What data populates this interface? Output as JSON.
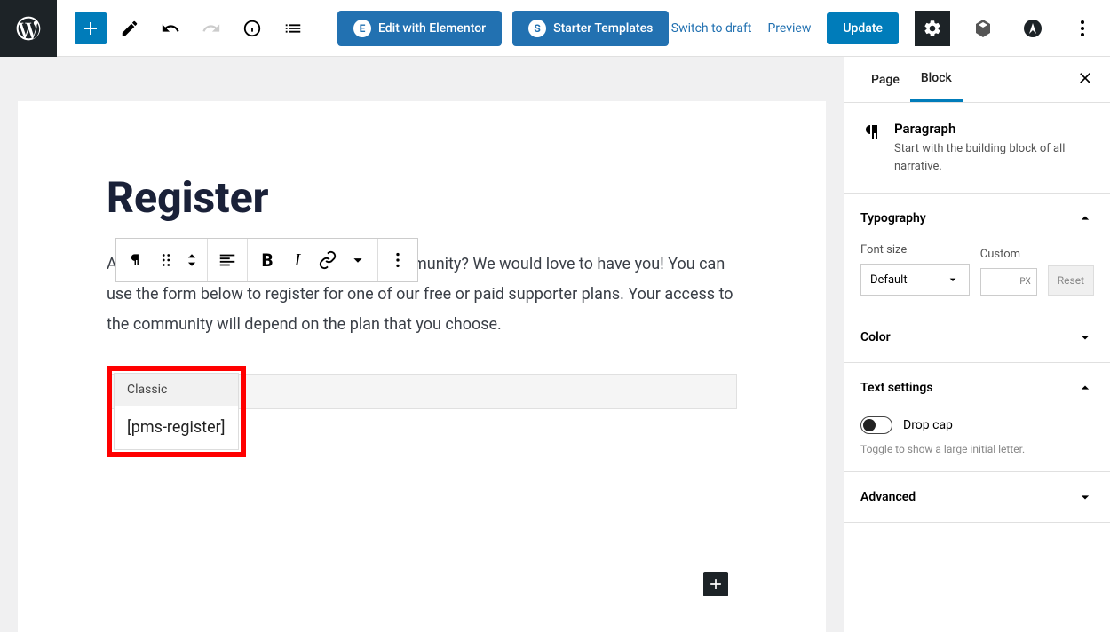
{
  "toolbar": {
    "elementor_label": "Edit with Elementor",
    "starter_label": "Starter Templates",
    "switch_draft": "Switch to draft",
    "preview": "Preview",
    "update": "Update"
  },
  "page": {
    "title": "Register",
    "paragraph": "Are you interested in joining our online community? We would love to have you! You can use the form below to register for one of our free or paid supporter plans. Your access to the community will depend on the plan that you choose."
  },
  "classic_block": {
    "header": "Classic",
    "content": "[pms-register]"
  },
  "sidebar": {
    "tabs": {
      "page": "Page",
      "block": "Block"
    },
    "block_info": {
      "title": "Paragraph",
      "desc": "Start with the building block of all narrative."
    },
    "typography": {
      "title": "Typography",
      "font_size_label": "Font size",
      "font_size_value": "Default",
      "custom_label": "Custom",
      "custom_unit": "PX",
      "reset": "Reset"
    },
    "color": {
      "title": "Color"
    },
    "text_settings": {
      "title": "Text settings",
      "drop_cap": "Drop cap",
      "help": "Toggle to show a large initial letter."
    },
    "advanced": {
      "title": "Advanced"
    }
  }
}
